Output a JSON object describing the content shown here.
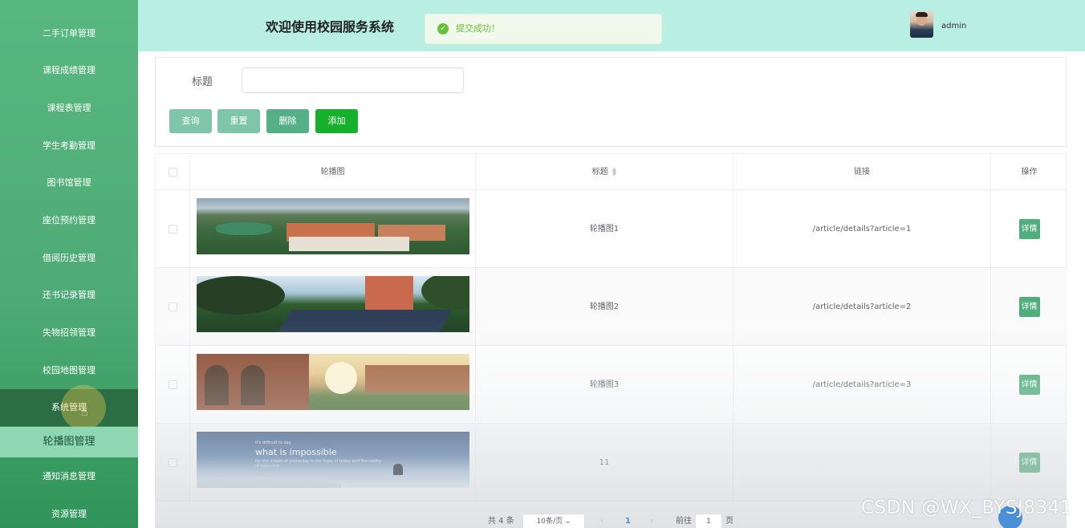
{
  "sidebar": {
    "items": [
      {
        "label": "二手订单管理"
      },
      {
        "label": "课程成绩管理"
      },
      {
        "label": "课程表管理"
      },
      {
        "label": "学生考勤管理"
      },
      {
        "label": "图书馆管理"
      },
      {
        "label": "座位预约管理"
      },
      {
        "label": "借阅历史管理"
      },
      {
        "label": "还书记录管理"
      },
      {
        "label": "失物招领管理"
      },
      {
        "label": "校园地图管理"
      },
      {
        "label": "系统管理"
      },
      {
        "label": "轮播图管理"
      },
      {
        "label": "通知消息管理"
      },
      {
        "label": "资源管理"
      }
    ],
    "active_group": "系统管理",
    "active_item": "轮播图管理"
  },
  "header": {
    "title": "欢迎使用校园服务系统",
    "toast": "提交成功！",
    "toast_icon": "check-circle-icon",
    "username": "admin"
  },
  "search": {
    "title_label": "标题",
    "title_value": "",
    "query_label": "查询",
    "reset_label": "重置",
    "delete_label": "删除",
    "add_label": "添加"
  },
  "table": {
    "headers": {
      "image": "轮播图",
      "title": "标题",
      "link": "链接",
      "actions": "操作"
    },
    "rows": [
      {
        "title": "轮播图1",
        "link": "/article/details?article=1",
        "action": "详情"
      },
      {
        "title": "轮播图2",
        "link": "/article/details?article=2",
        "action": "详情"
      },
      {
        "title": "轮播图3",
        "link": "/article/details?article=3",
        "action": "详情"
      },
      {
        "title": "11",
        "link": "",
        "action": "详情",
        "image_text": {
          "line1": "it's difficult to say",
          "line2": "what is impossible",
          "line3": "for the dream of yesterday is the hope of today and the reality of tomorrow"
        }
      }
    ]
  },
  "pagination": {
    "total": "共 4 条",
    "page_size": "10条/页",
    "current_page": "1",
    "goto_label": "前往",
    "goto_value": "1",
    "page_unit": "页"
  },
  "watermark": "CSDN @WX_BYSJ8341",
  "colors": {
    "sidebar": "#4fab76",
    "header": "#b9eee2",
    "accent": "#17b02d",
    "detail_button": "#4fae7c"
  }
}
